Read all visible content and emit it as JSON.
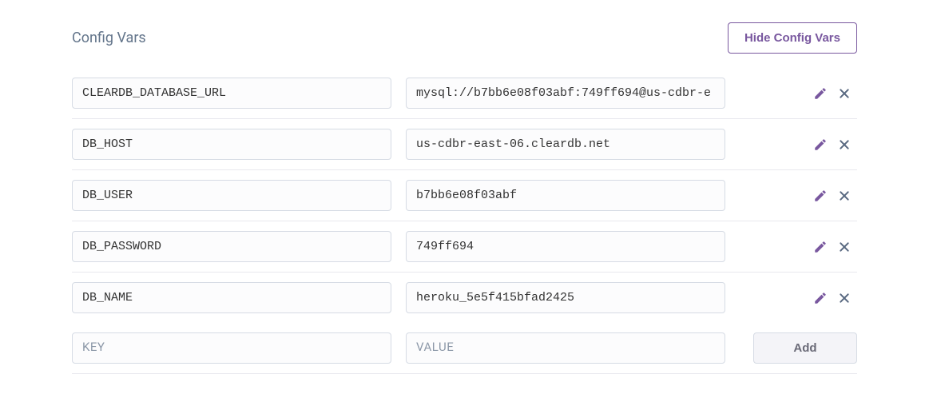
{
  "title": "Config Vars",
  "hide_button": "Hide Config Vars",
  "add_button": "Add",
  "new_row": {
    "key_placeholder": "KEY",
    "value_placeholder": "VALUE"
  },
  "vars": [
    {
      "key": "CLEARDB_DATABASE_URL",
      "value": "mysql://b7bb6e08f03abf:749ff694@us-cdbr-e"
    },
    {
      "key": "DB_HOST",
      "value": "us-cdbr-east-06.cleardb.net"
    },
    {
      "key": "DB_USER",
      "value": "b7bb6e08f03abf"
    },
    {
      "key": "DB_PASSWORD",
      "value": "749ff694"
    },
    {
      "key": "DB_NAME",
      "value": "heroku_5e5f415bfad2425"
    }
  ]
}
